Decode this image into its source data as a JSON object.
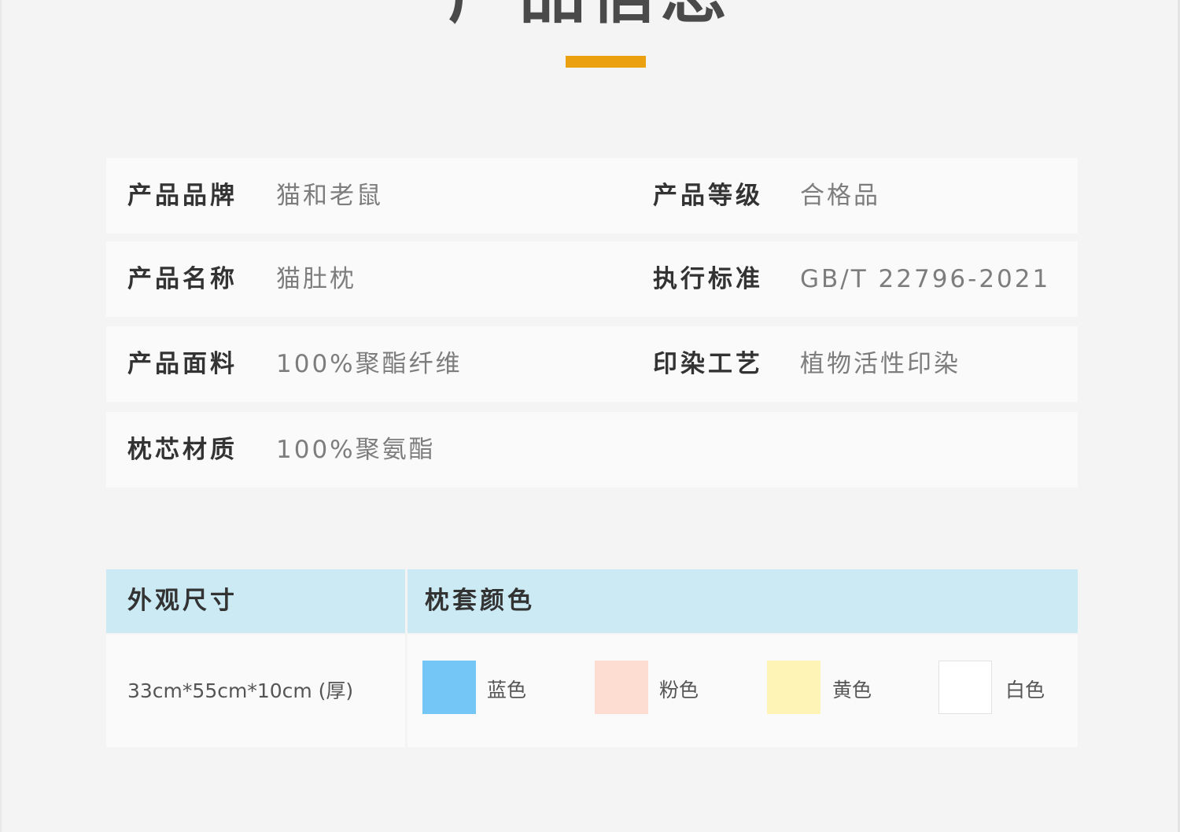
{
  "header": {
    "title": "产品信息",
    "underline_color": "#eba10f"
  },
  "info_rows": [
    {
      "left_label": "产品品牌",
      "left_value": "猫和老鼠",
      "right_label": "产品等级",
      "right_value": "合格品"
    },
    {
      "left_label": "产品名称",
      "left_value": "猫肚枕",
      "right_label": "执行标准",
      "right_value": "GB/T 22796-2021"
    },
    {
      "left_label": "产品面料",
      "left_value": "100%聚酯纤维",
      "right_label": "印染工艺",
      "right_value": "植物活性印染"
    },
    {
      "left_label": "枕芯材质",
      "left_value": "100%聚氨酯"
    }
  ],
  "specs": {
    "size_header": "外观尺寸",
    "color_header": "枕套颜色",
    "size_value": "33cm*55cm*10cm (厚)",
    "header_bg": "#cbeaf4",
    "colors": [
      {
        "name": "蓝色",
        "swatch": "#74c6f6"
      },
      {
        "name": "粉色",
        "swatch": "#fddcd1"
      },
      {
        "name": "黄色",
        "swatch": "#fdf4b5"
      },
      {
        "name": "白色",
        "swatch": "#ffffff"
      }
    ]
  }
}
